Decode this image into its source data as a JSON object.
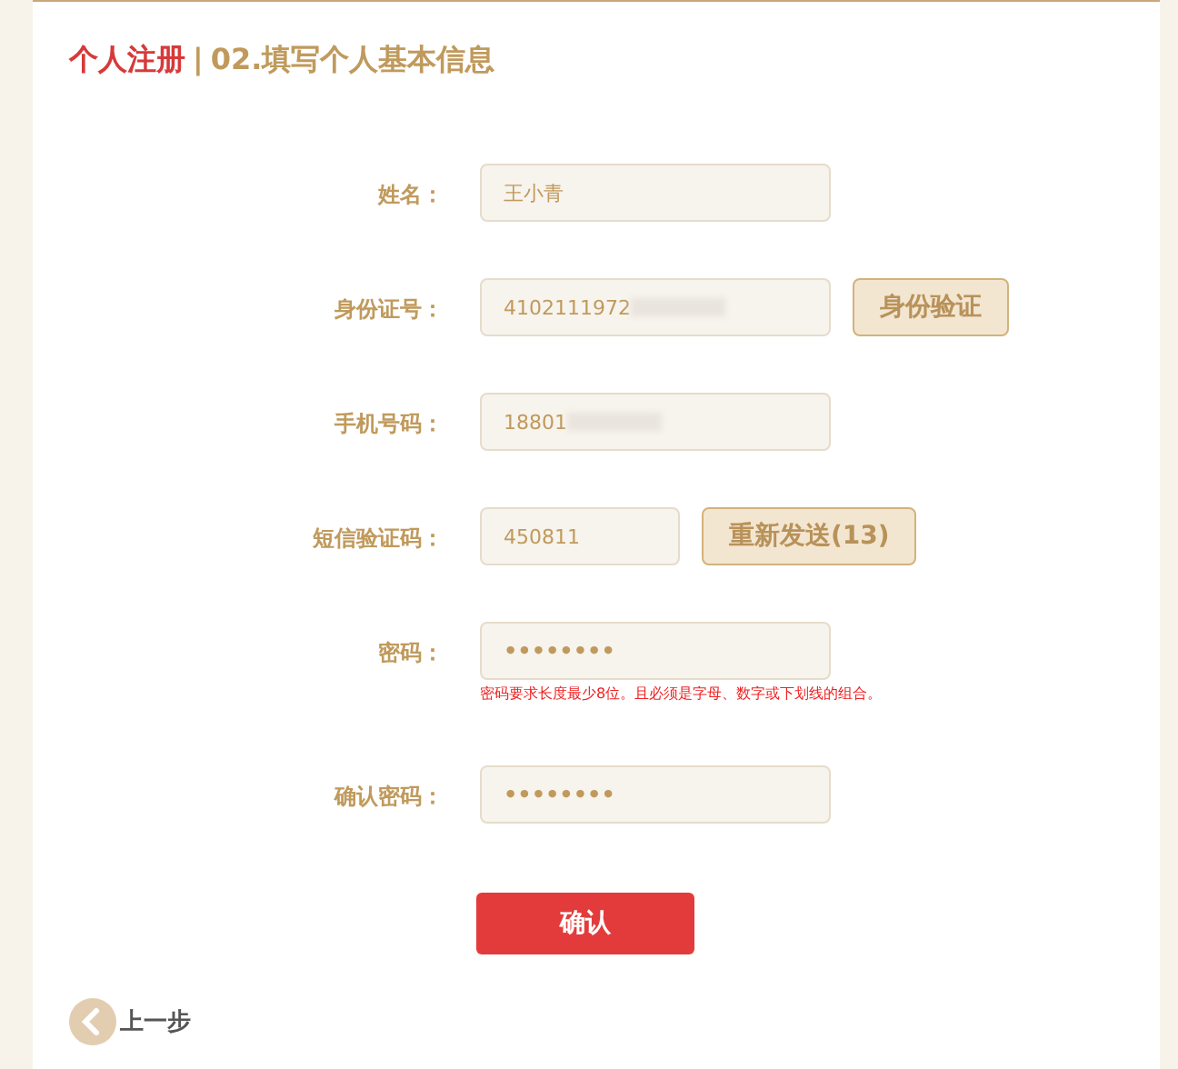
{
  "title": {
    "section": "个人注册",
    "separator": "|",
    "step": "02.填写个人基本信息"
  },
  "fields": [
    {
      "label": "姓名：",
      "value": "王小青",
      "kind": "text"
    },
    {
      "label": "身份证号：",
      "value": "4102111972",
      "kind": "masked",
      "button": "身份验证"
    },
    {
      "label": "手机号码：",
      "value": "18801",
      "kind": "masked"
    },
    {
      "label": "短信验证码：",
      "value": "450811",
      "kind": "code",
      "button": "重新发送(13)"
    },
    {
      "label": "密码：",
      "value": "••••••••",
      "kind": "password",
      "hint": "密码要求长度最少8位。且必须是字母、数字或下划线的组合。"
    },
    {
      "label": "确认密码：",
      "value": "••••••••",
      "kind": "password"
    }
  ],
  "submit": "确认",
  "back": "上一步"
}
